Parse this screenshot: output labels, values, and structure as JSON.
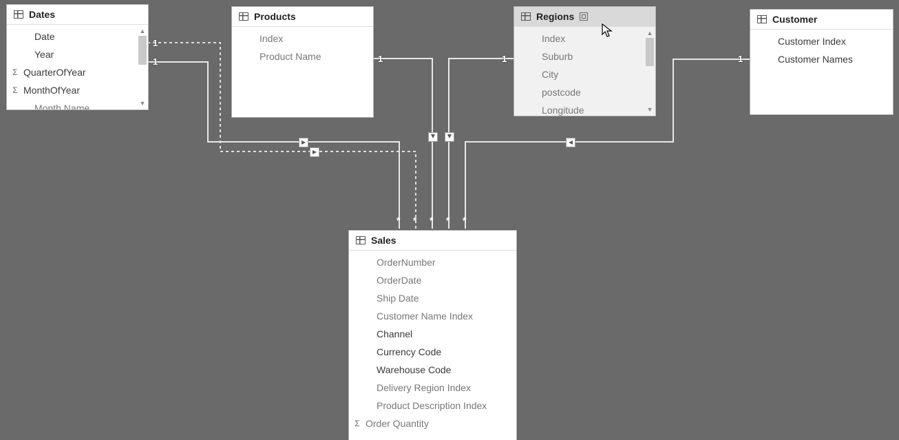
{
  "tables": {
    "dates": {
      "title": "Dates",
      "fields": [
        {
          "name": "Date",
          "sigma": false,
          "dim": false
        },
        {
          "name": "Year",
          "sigma": false,
          "dim": false
        },
        {
          "name": "QuarterOfYear",
          "sigma": true,
          "dim": false
        },
        {
          "name": "MonthOfYear",
          "sigma": true,
          "dim": false
        },
        {
          "name": "Month Name",
          "sigma": false,
          "dim": true
        }
      ]
    },
    "products": {
      "title": "Products",
      "fields": [
        {
          "name": "Index",
          "sigma": false,
          "dim": true
        },
        {
          "name": "Product Name",
          "sigma": false,
          "dim": true
        }
      ]
    },
    "regions": {
      "title": "Regions",
      "selected": true,
      "fields": [
        {
          "name": "Index",
          "sigma": false,
          "dim": true
        },
        {
          "name": "Suburb",
          "sigma": false,
          "dim": true
        },
        {
          "name": "City",
          "sigma": false,
          "dim": true
        },
        {
          "name": "postcode",
          "sigma": false,
          "dim": true
        },
        {
          "name": "Longitude",
          "sigma": false,
          "dim": true
        }
      ]
    },
    "customer": {
      "title": "Customer",
      "fields": [
        {
          "name": "Customer Index",
          "sigma": false,
          "dim": false
        },
        {
          "name": "Customer Names",
          "sigma": false,
          "dim": false
        }
      ]
    },
    "sales": {
      "title": "Sales",
      "fields": [
        {
          "name": "OrderNumber",
          "sigma": false,
          "dim": true
        },
        {
          "name": "OrderDate",
          "sigma": false,
          "dim": true
        },
        {
          "name": "Ship Date",
          "sigma": false,
          "dim": true
        },
        {
          "name": "Customer Name Index",
          "sigma": false,
          "dim": true
        },
        {
          "name": "Channel",
          "sigma": false,
          "dim": false
        },
        {
          "name": "Currency Code",
          "sigma": false,
          "dim": false
        },
        {
          "name": "Warehouse Code",
          "sigma": false,
          "dim": false
        },
        {
          "name": "Delivery Region Index",
          "sigma": false,
          "dim": true
        },
        {
          "name": "Product Description Index",
          "sigma": false,
          "dim": true
        },
        {
          "name": "Order Quantity",
          "sigma": true,
          "dim": true
        }
      ]
    }
  },
  "cardinality": {
    "one": "1",
    "many": "*"
  },
  "relationships": [
    {
      "from": "dates",
      "to": "sales",
      "active": true,
      "fromCard": "1",
      "toCard": "*"
    },
    {
      "from": "dates",
      "to": "sales",
      "active": false,
      "fromCard": "1",
      "toCard": "*"
    },
    {
      "from": "products",
      "to": "sales",
      "active": true,
      "fromCard": "1",
      "toCard": "*"
    },
    {
      "from": "regions",
      "to": "sales",
      "active": true,
      "fromCard": "1",
      "toCard": "*"
    },
    {
      "from": "customer",
      "to": "sales",
      "active": true,
      "fromCard": "1",
      "toCard": "*"
    }
  ]
}
